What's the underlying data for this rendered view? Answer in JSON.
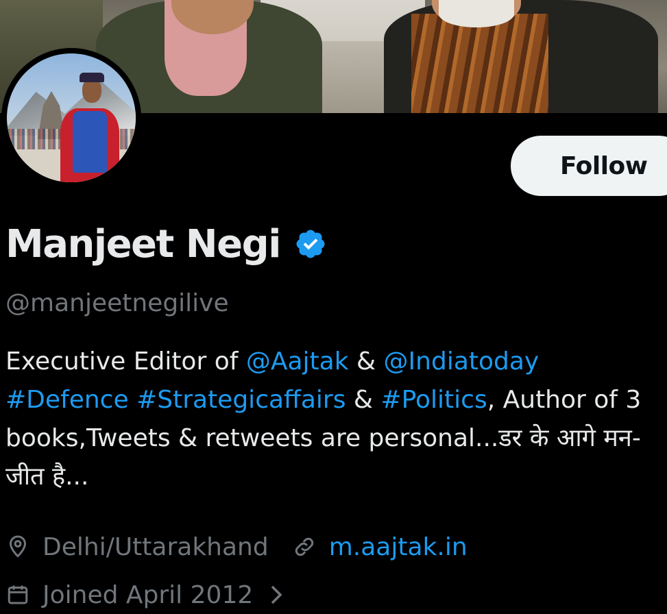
{
  "profile": {
    "display_name": "Manjeet Negi",
    "handle": "@manjeetnegilive",
    "verified": true,
    "follow_label": "Follow",
    "bio": {
      "part1": "Executive Editor of ",
      "mention1": "@Aajtak",
      "amp1": " & ",
      "mention2": "@Indiatoday",
      "hashtag1": "#Defence",
      "space1": " ",
      "hashtag2": "#Strategicaffairs",
      "amp2": " & ",
      "hashtag3": "#Politics",
      "part2": ", Author of 3 books,Tweets & retweets are personal...डर के आगे मन-जीत है..."
    },
    "location": "Delhi/Uttarakhand",
    "website": "m.aajtak.in",
    "joined": "Joined April 2012"
  },
  "icons": {
    "verified": "verified-badge-icon",
    "location": "location-pin-icon",
    "link": "link-icon",
    "calendar": "calendar-icon",
    "chevron": "chevron-right-icon"
  },
  "colors": {
    "background": "#000000",
    "text_primary": "#e7e9ea",
    "text_secondary": "#71767b",
    "link": "#1d9bf0",
    "follow_bg": "#eff3f4",
    "follow_text": "#0f1419"
  }
}
